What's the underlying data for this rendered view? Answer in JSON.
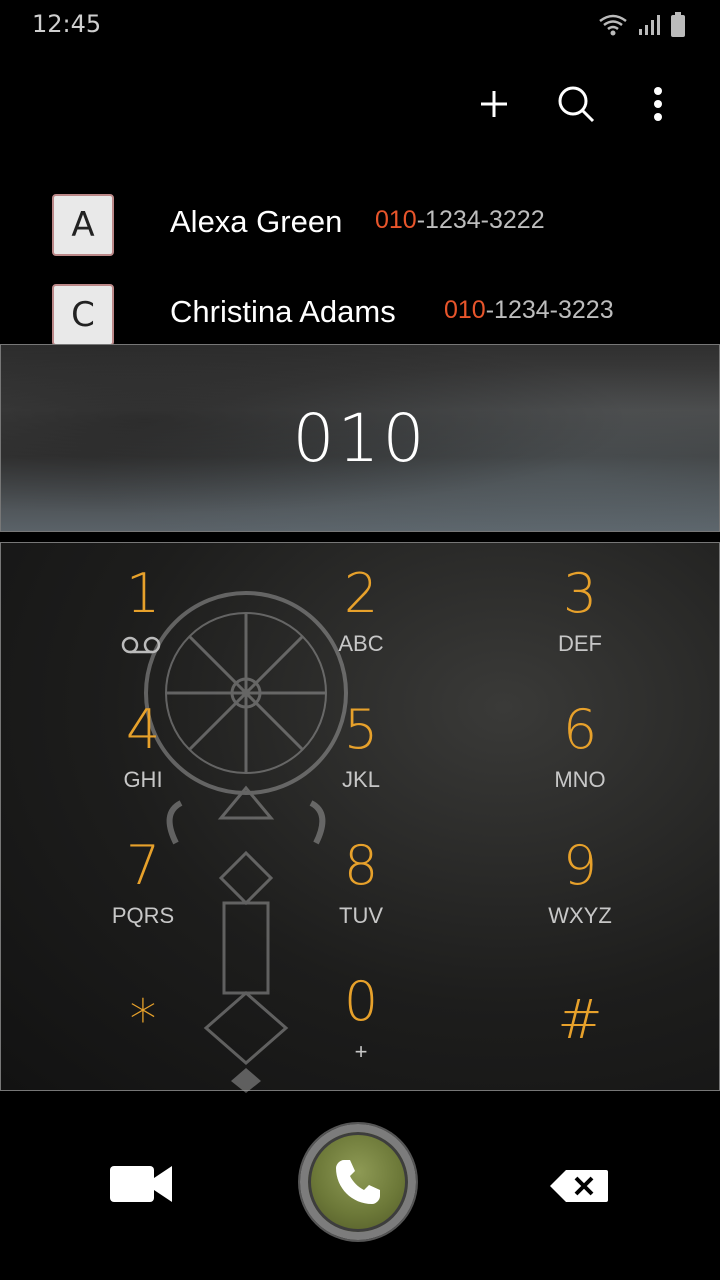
{
  "status_bar": {
    "time": "12:45"
  },
  "contacts": [
    {
      "initial": "A",
      "name": "Alexa Green",
      "number_match": "010",
      "number_rest": "-1234-3222"
    },
    {
      "initial": "C",
      "name": "Christina Adams",
      "number_match": "010",
      "number_rest": "-1234-3223"
    }
  ],
  "dialed_number": "010",
  "keypad": [
    {
      "digit": "1",
      "letters": ""
    },
    {
      "digit": "2",
      "letters": "ABC"
    },
    {
      "digit": "3",
      "letters": "DEF"
    },
    {
      "digit": "4",
      "letters": "GHI"
    },
    {
      "digit": "5",
      "letters": "JKL"
    },
    {
      "digit": "6",
      "letters": "MNO"
    },
    {
      "digit": "7",
      "letters": "PQRS"
    },
    {
      "digit": "8",
      "letters": "TUV"
    },
    {
      "digit": "9",
      "letters": "WXYZ"
    },
    {
      "digit": "*",
      "letters": ""
    },
    {
      "digit": "0",
      "letters": "+"
    },
    {
      "digit": "#",
      "letters": ""
    }
  ],
  "icons": {
    "add": "plus-icon",
    "search": "search-icon",
    "more": "more-vert-icon",
    "voicemail": "voicemail-icon",
    "video": "video-call-icon",
    "call": "phone-icon",
    "backspace": "backspace-icon"
  },
  "colors": {
    "digit": "#e7a12b",
    "match": "#e8552b",
    "call_button": "#6c7838"
  }
}
